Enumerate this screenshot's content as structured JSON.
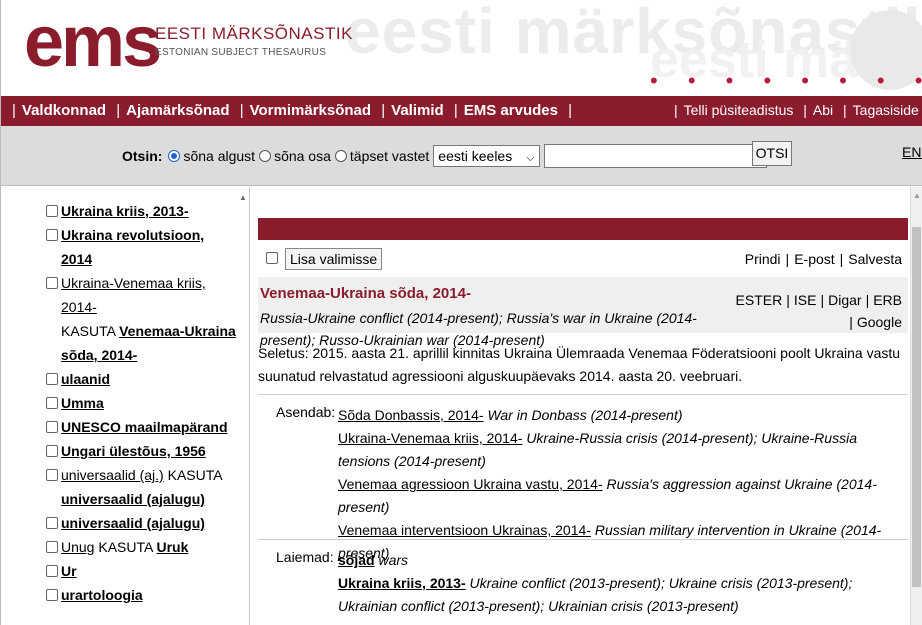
{
  "header": {
    "logo_e": "e",
    "logo_ms": "ms",
    "title": "EESTI MÄRKSÕNASTIK",
    "subtitle": "ESTONIAN SUBJECT THESAURUS",
    "watermark": "eesti märksõnastik",
    "watermark2": "eesti märksõnastik",
    "dots": "• • • • • • • • • • •",
    "brand_color": "#8b1c2e"
  },
  "nav": {
    "left": [
      "Valdkonnad",
      "Ajamärksõnad",
      "Vormimärksõnad",
      "Valimid",
      "EMS arvudes"
    ],
    "right": [
      "Telli püsiteadistus",
      "Abi",
      "Tagasiside"
    ]
  },
  "search": {
    "label": "Otsin:",
    "options": [
      "sõna algust",
      "sõna osa",
      "täpset vastet"
    ],
    "selected_option": "sõna algust",
    "language_select": "eesti keeles",
    "query_value": "",
    "button": "OTSI",
    "lang_link": "ENG"
  },
  "sidebar": {
    "items": [
      {
        "term": "Ukraina kriis, 2013-",
        "bold": true
      },
      {
        "term": "Ukraina revolutsioon, 2014",
        "bold": true
      },
      {
        "term": "Ukraina-Venemaa kriis, 2014-",
        "bold": false,
        "use_text": "KASUTA",
        "use_term": "Venemaa-Ukraina sõda, 2014-"
      },
      {
        "term": "ulaanid",
        "bold": true
      },
      {
        "term": "Umma",
        "bold": true
      },
      {
        "term": "UNESCO maailmapärand",
        "bold": true
      },
      {
        "term": "Ungari ülestõus, 1956",
        "bold": true
      },
      {
        "term": "universaalid (aj.)",
        "bold": false,
        "use_text": "KASUTA",
        "use_term": "universaalid (ajalugu)"
      },
      {
        "term": "universaalid (ajalugu)",
        "bold": true
      },
      {
        "term": "Unug",
        "bold": false,
        "use_text": "KASUTA",
        "use_term": "Uruk"
      },
      {
        "term": "Ur",
        "bold": true
      },
      {
        "term": "urartoloogia",
        "bold": true
      }
    ]
  },
  "toolbar": {
    "add_button": "Lisa valimisse",
    "actions": [
      "Prindi",
      "E-post",
      "Salvesta"
    ]
  },
  "entry": {
    "title": "Venemaa-Ukraina sõda, 2014-",
    "english": "Russia-Ukraine conflict (2014-present); Russia's war in Ukraine (2014-present); Russo-Ukrainian war (2014-present)",
    "links_row1": [
      "ESTER",
      "ISE",
      "Digar",
      "ERB"
    ],
    "links_row2": [
      "Google"
    ],
    "explanation": "Seletus: 2015. aasta 21. aprillil kinnitas Ukraina Ülemraada Venemaa Föderatsiooni poolt Ukraina vastu suunatud relvastatud agressiooni alguskuupäevaks 2014. aasta 20. veebruari.",
    "replaces_label": "Asendab:",
    "replaces": [
      {
        "term": "Sõda Donbassis, 2014-",
        "en": "War in Donbass (2014-present)"
      },
      {
        "term": "Ukraina-Venemaa kriis, 2014-",
        "en": "Ukraine-Russia crisis (2014-present); Ukraine-Russia tensions (2014-present)"
      },
      {
        "term": "Venemaa agressioon Ukraina vastu, 2014-",
        "en": "Russia's aggression against Ukraine (2014-present)"
      },
      {
        "term": "Venemaa interventsioon Ukrainas, 2014-",
        "en": "Russian military intervention in Ukraine (2014-present)"
      }
    ],
    "broader_label": "Laiemad:",
    "broader": [
      {
        "term": "sõjad",
        "en": "wars"
      },
      {
        "term": "Ukraina kriis, 2013-",
        "en": "Ukraine conflict (2013-present); Ukraine crisis (2013-present); Ukrainian conflict (2013-present); Ukrainian crisis (2013-present)"
      }
    ]
  }
}
